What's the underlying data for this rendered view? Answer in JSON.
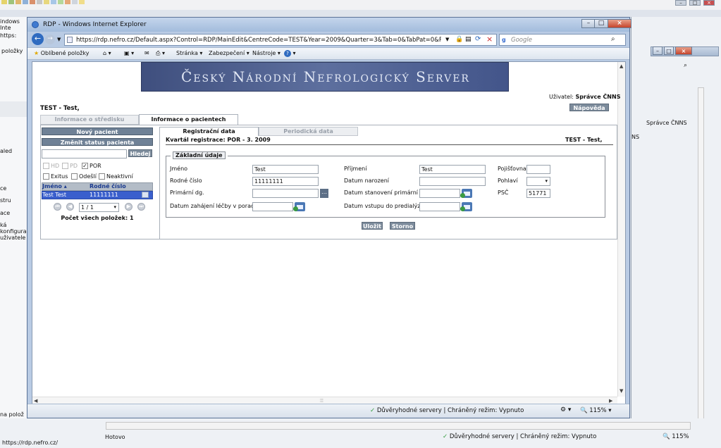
{
  "behind": {
    "tab_label": "indows Inte",
    "address_prefix": "https:",
    "fav_label": "položky",
    "left_items": [
      "aled",
      "ce",
      "stru",
      "ace",
      "ká konfigura",
      "uživatele"
    ],
    "right_user": "Správce ČNNS",
    "right_ns": "NS",
    "bottom_left_text": "na polož",
    "status_url": "https://rdp.nefro.cz/",
    "status_done": "Hotovo",
    "status_trusted": "Důvěryhodné servery | Chráněný režim: Vypnuto",
    "zoom": "115%"
  },
  "window": {
    "title": "RDP - Windows Internet Explorer",
    "address": "https://rdp.nefro.cz/Default.aspx?Control=RDP/MainEdit&CentreCode=TEST&Year=2009&Quarter=3&Tab=0&TabPat=0&Patient=&SortC",
    "search_placeholder": "Google",
    "favorites_label": "Oblíbené položky",
    "menu": {
      "page": "Stránka",
      "security": "Zabezpečení",
      "tools": "Nástroje"
    },
    "status_trusted": "Důvěryhodné servery | Chráněný režim: Vypnuto",
    "zoom": "115%"
  },
  "page": {
    "banner": "Český Národní Nefrologický Server",
    "user_label": "Uživatel:",
    "user_name": "Správce ČNNS",
    "centre": "TEST - Test,",
    "help_button": "Nápověda",
    "tabs": {
      "centre_info": "Informace o středisku",
      "patient_info": "Informace o pacientech"
    },
    "left": {
      "new_patient": "Nový pacient",
      "change_status": "Změnit status pacienta",
      "search_button": "Hledej",
      "search_value": "",
      "filters": {
        "hd": "HD",
        "pd": "PD",
        "por": "POR",
        "exitus": "Exitus",
        "left": "Odešlí",
        "inactive": "Neaktivní"
      },
      "columns": {
        "name": "Jméno",
        "birth": "Rodné číslo"
      },
      "rows": [
        {
          "name": "Test Test",
          "birth": "11111111"
        }
      ],
      "pager": "1 / 1",
      "total": "Počet všech položek: 1"
    },
    "subtabs": {
      "reg": "Registrační data",
      "periodic": "Periodická data"
    },
    "quarter": "Kvartál registrace: POR - 3. 2009",
    "patient_header": "TEST - Test,",
    "section_title": "Základní údaje",
    "form": {
      "first_name_label": "Jméno",
      "first_name": "Test",
      "surname_label": "Příjmení",
      "surname": "Test",
      "insurance_label": "Pojišťovna",
      "insurance": "",
      "birth_no_label": "Rodné číslo",
      "birth_no": "11111111",
      "birth_date_label": "Datum narození",
      "birth_date": "",
      "sex_label": "Pohlaví",
      "sex": "",
      "primary_dg_label": "Primární dg.",
      "primary_dg": "",
      "primary_dg_date_label": "Datum stanovení primární dg.",
      "primary_dg_date": "",
      "zip_label": "PSČ",
      "zip": "51771",
      "treatment_start_label": "Datum zahájení léčby v poradně",
      "treatment_start": "",
      "predialysis_label": "Datum vstupu do predialýzy",
      "predialysis": ""
    },
    "save_button": "Uložit",
    "cancel_button": "Storno"
  },
  "colors": {
    "banner_bg": "#4b5d8e",
    "banner_text": "#e2e8f5",
    "button_grey": "#7d8c9c",
    "selection": "#3a5fcd"
  }
}
